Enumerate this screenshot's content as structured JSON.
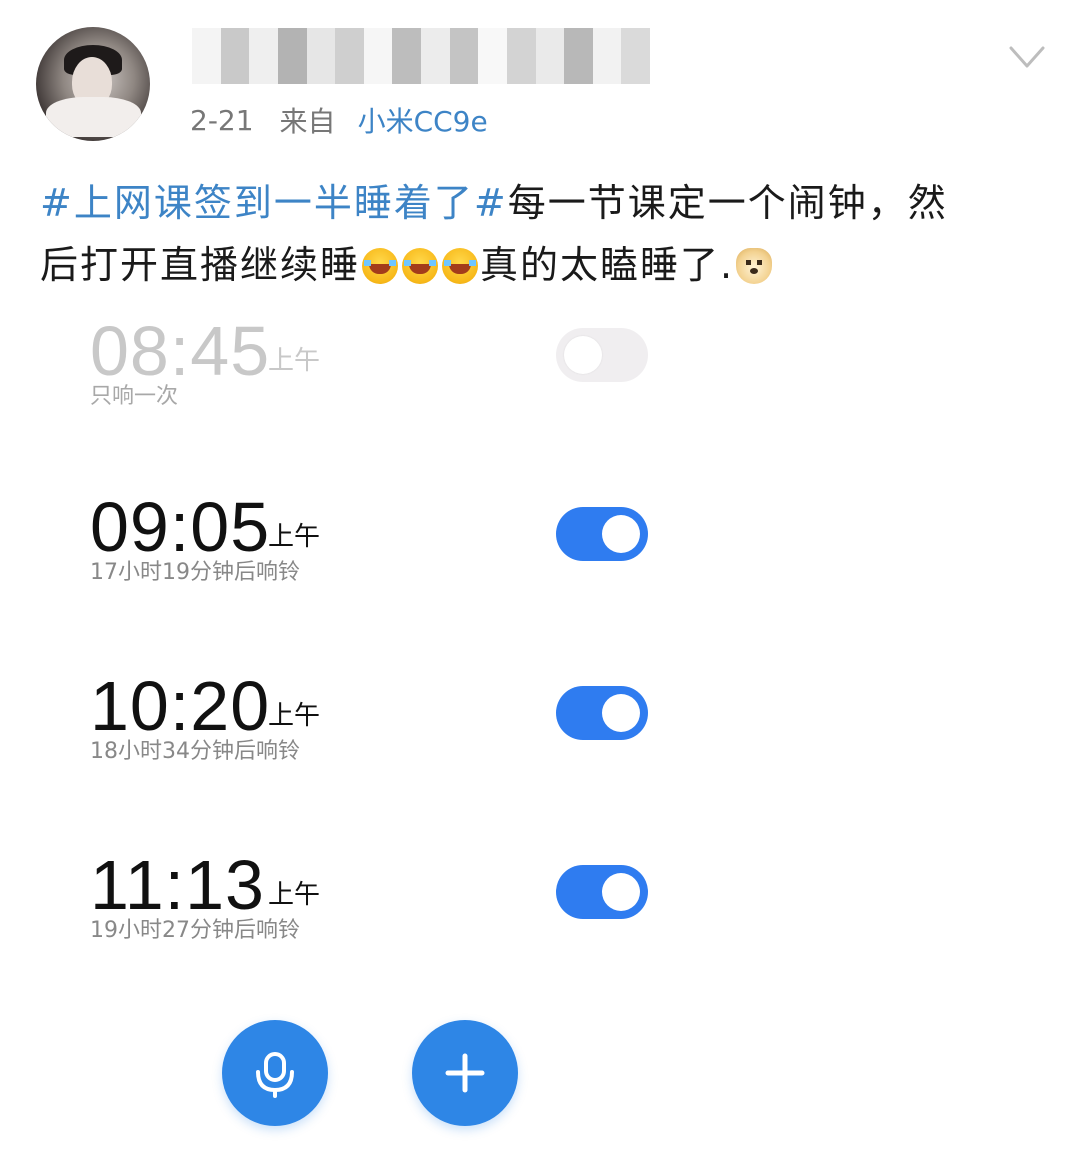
{
  "post": {
    "username_pixelated": "",
    "date": "2-21",
    "source_label": "来自",
    "source_device": "小米CC9e",
    "text": {
      "hashtag": "#上网课签到一半睡着了#",
      "line1_rest": "每一节课定一个闹钟，然",
      "line2_start": "后打开直播继续睡",
      "line2_end": "真的太瞌睡了.",
      "emojis": [
        "laugh-cry-emoji",
        "laugh-cry-emoji",
        "laugh-cry-emoji",
        "doge-emoji"
      ]
    }
  },
  "alarms": [
    {
      "time": "08:45",
      "ampm": "上午",
      "subtitle": "只响一次",
      "enabled": false
    },
    {
      "time": "09:05",
      "ampm": "上午",
      "subtitle": "17小时19分钟后响铃",
      "enabled": true
    },
    {
      "time": "10:20",
      "ampm": "上午",
      "subtitle": "18小时34分钟后响铃",
      "enabled": true
    },
    {
      "time": "11:13",
      "ampm": "上午",
      "subtitle": "19小时27分钟后响铃",
      "enabled": true
    }
  ],
  "actions": {
    "voice_icon": "microphone-icon",
    "add_icon": "plus-icon"
  },
  "colors": {
    "accent_blue": "#3d84c6",
    "toggle_on": "#2f7cf0",
    "fab": "#2e86e6"
  }
}
